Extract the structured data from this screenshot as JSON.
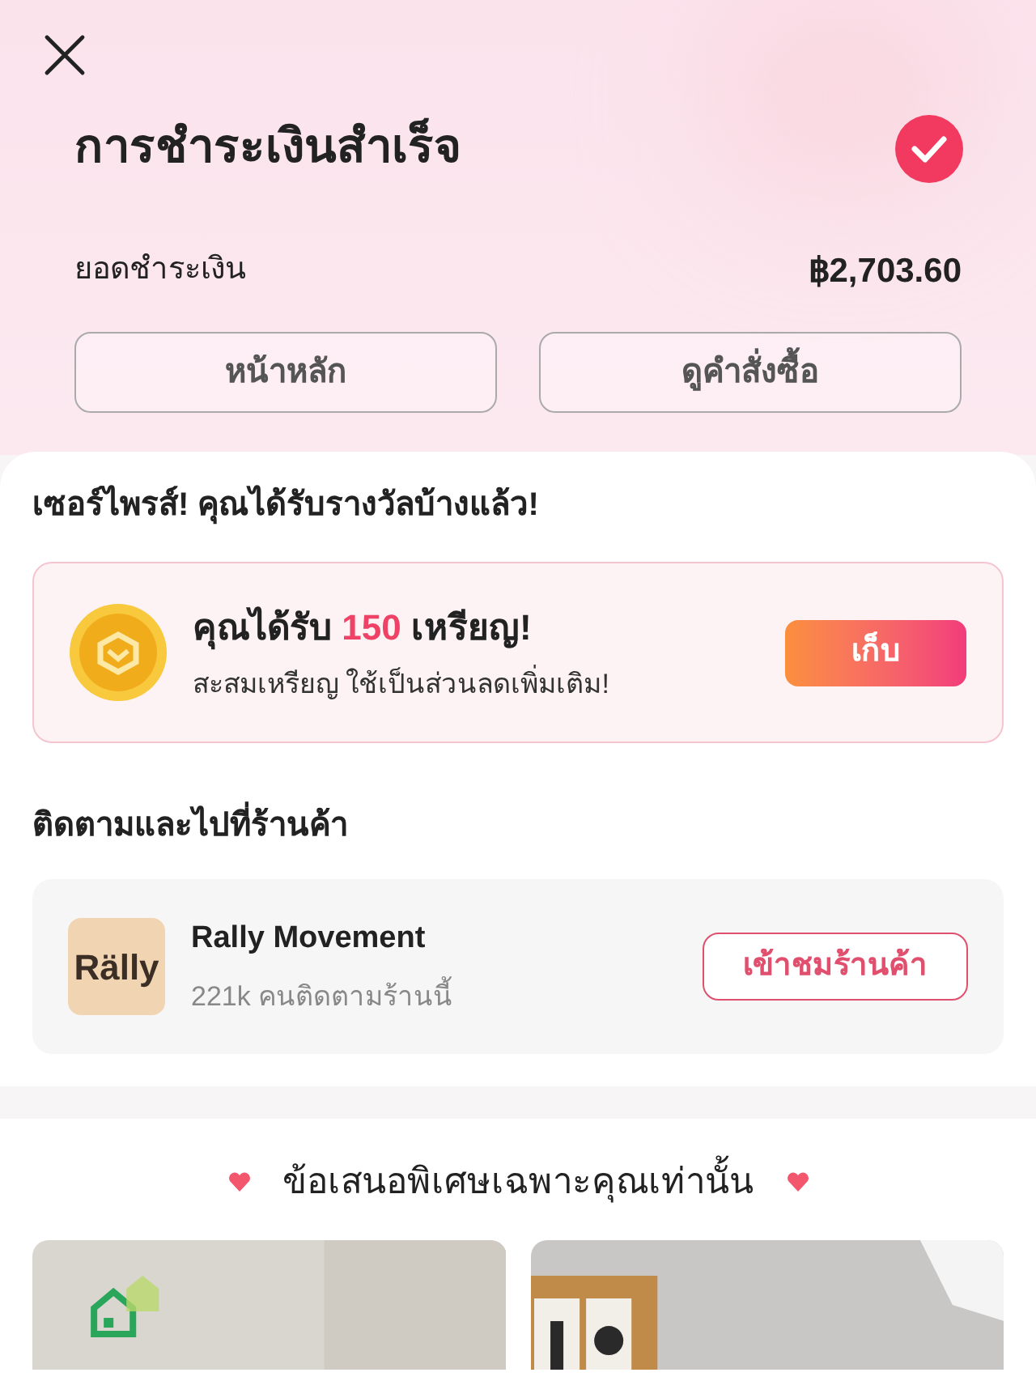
{
  "header": {
    "title": "การชำระเงินสำเร็จ",
    "amount_label": "ยอดชำระเงิน",
    "amount": "฿2,703.60",
    "buttons": [
      "หน้าหลัก",
      "ดูคำสั่งซื้อ"
    ]
  },
  "reward": {
    "heading": "เซอร์ไพรส์! คุณได้รับรางวัลบ้างแล้ว!",
    "title_before": "คุณได้รับ ",
    "coins": "150",
    "title_after": " เหรียญ!",
    "subtitle": "สะสมเหรียญ ใช้เป็นส่วนลดเพิ่มเติม!",
    "button": "เก็บ"
  },
  "follow": {
    "heading": "ติดตามและไปที่ร้านค้า",
    "store_logo": "Rälly",
    "store_name": "Rally Movement",
    "followers": "221k คนติดตามร้านนี้",
    "button": "เข้าชมร้านค้า"
  },
  "offers": {
    "heading": "ข้อเสนอพิเศษเฉพาะคุณเท่านั้น"
  }
}
